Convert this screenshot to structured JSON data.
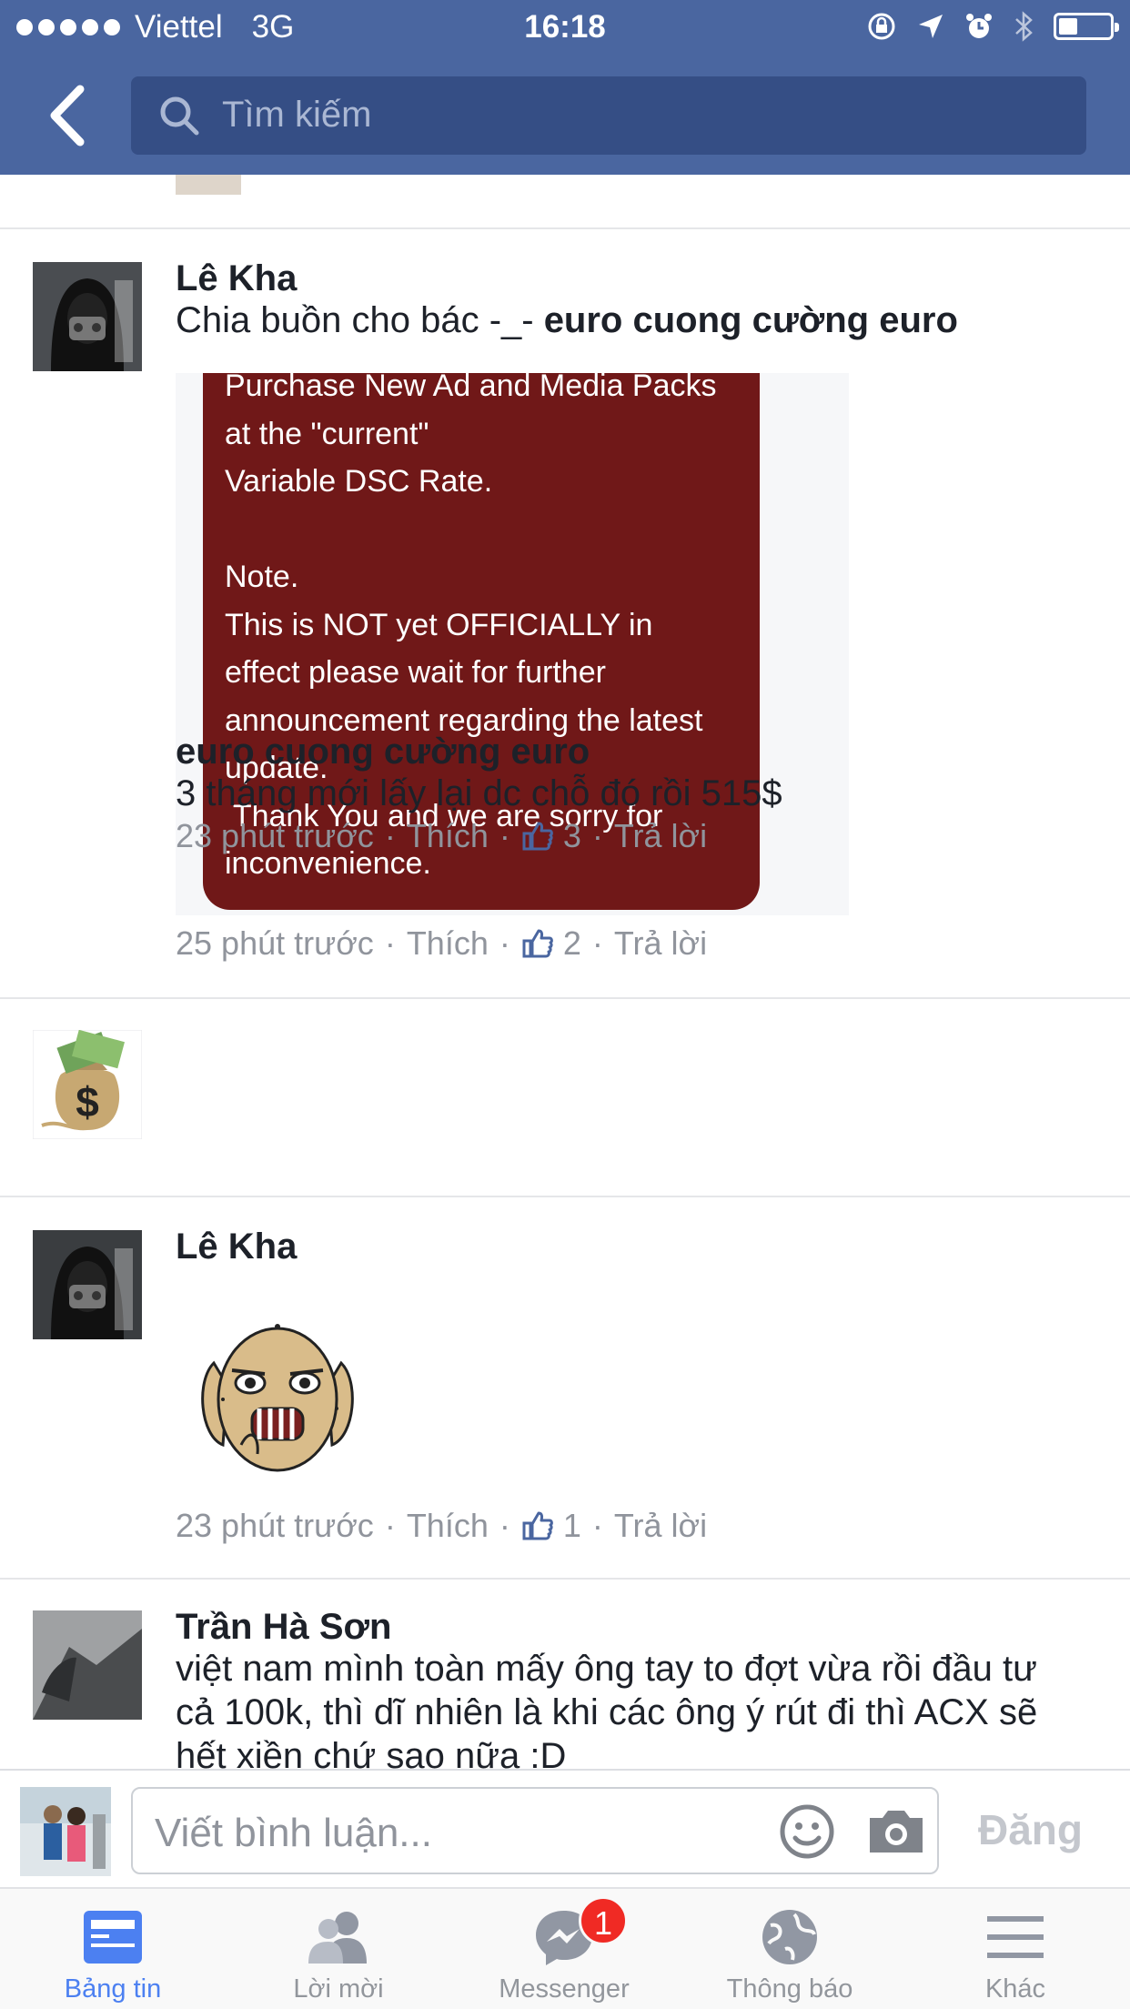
{
  "status_bar": {
    "carrier": "Viettel",
    "network": "3G",
    "time": "16:18"
  },
  "search": {
    "placeholder": "Tìm kiếm"
  },
  "comments": [
    {
      "author": "Lê Kha",
      "text_plain": "Chia buồn cho bác -_- ",
      "text_tag": "euro cuong cường euro",
      "image_lines": [
        "Purchase New Ad and Media Packs",
        "at the \"current\"",
        "Variable DSC Rate.",
        "",
        "Note.",
        "This is NOT yet OFFICIALLY in",
        "effect please wait for further",
        "announcement regarding the latest",
        "update.",
        " Thank You and we are sorry for",
        "inconvenience."
      ],
      "time": "25 phút trước",
      "like": "Thích",
      "likes": "2",
      "reply": "Trả lời"
    },
    {
      "author": "euro cuong cường euro",
      "text": "3 tháng mới lấy lại dc chỗ đó rồi 515$",
      "time": "23 phút trước",
      "like": "Thích",
      "likes": "3",
      "reply": "Trả lời"
    },
    {
      "author": "Lê Kha",
      "time": "23 phút trước",
      "like": "Thích",
      "likes": "1",
      "reply": "Trả lời"
    },
    {
      "author": "Trần Hà Sơn",
      "text": "việt nam mình toàn mấy ông tay to đợt vừa rồi đầu tư cả 100k, thì dĩ nhiên là khi các ông ý rút đi thì ACX sẽ hết xiền chứ sao nữa :D"
    }
  ],
  "composer": {
    "placeholder": "Viết bình luận...",
    "post_label": "Đăng"
  },
  "tabs": [
    {
      "label": "Bảng tin",
      "icon": "news-feed-icon"
    },
    {
      "label": "Lời mời",
      "icon": "friend-requests-icon"
    },
    {
      "label": "Messenger",
      "icon": "messenger-icon",
      "badge": "1"
    },
    {
      "label": "Thông báo",
      "icon": "globe-icon"
    },
    {
      "label": "Khác",
      "icon": "menu-icon"
    }
  ],
  "colors": {
    "header": "#4a66a0",
    "active_tab": "#4c80f1",
    "badge": "#f02a24",
    "notice_bg": "#701818"
  }
}
